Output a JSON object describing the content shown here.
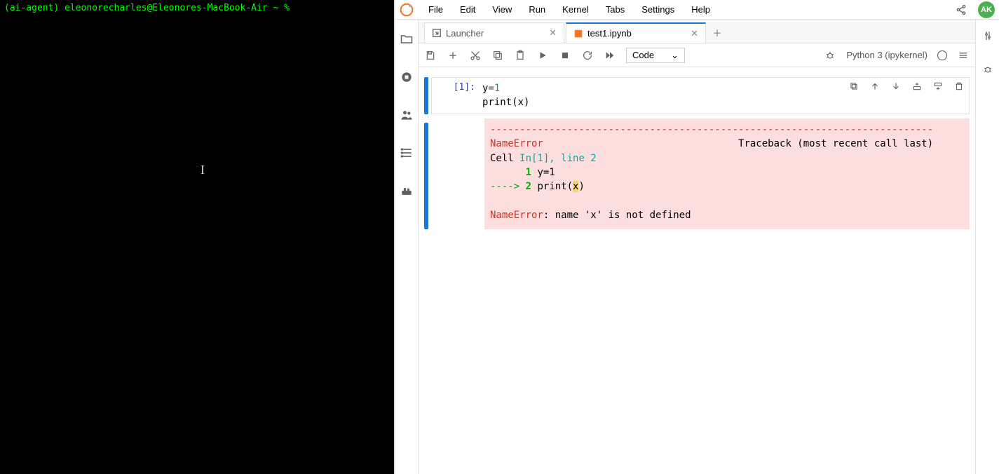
{
  "terminal": {
    "prompt_env": "(ai-agent) ",
    "prompt_userhost": "eleonorecharles@Eleonores-MacBook-Air ~ % "
  },
  "menubar": {
    "items": [
      "File",
      "Edit",
      "View",
      "Run",
      "Kernel",
      "Tabs",
      "Settings",
      "Help"
    ],
    "avatar": "AK"
  },
  "tabs": [
    {
      "label": "Launcher",
      "active": false
    },
    {
      "label": "test1.ipynb",
      "active": true
    }
  ],
  "toolbar": {
    "celltype": "Code",
    "kernel": "Python 3 (ipykernel)"
  },
  "cell": {
    "prompt": "[1]:",
    "code_line1_a": "y",
    "code_line1_b": "=",
    "code_line1_c": "1",
    "code_line2_a": "print",
    "code_line2_b": "(x)"
  },
  "output": {
    "divider": "---------------------------------------------------------------------------",
    "err_name": "NameError",
    "traceback_label": "Traceback (most recent call last)",
    "cell_loc_a": "Cell ",
    "cell_loc_b": "In[1], line 2",
    "line1_num": "      1",
    "line1_code": " y=1",
    "arrow": "----> ",
    "line2_num": "2",
    "line2_code_a": " print(",
    "line2_code_hl": "x",
    "line2_code_b": ")",
    "final_err": "NameError",
    "final_msg": ": name 'x' is not defined"
  }
}
